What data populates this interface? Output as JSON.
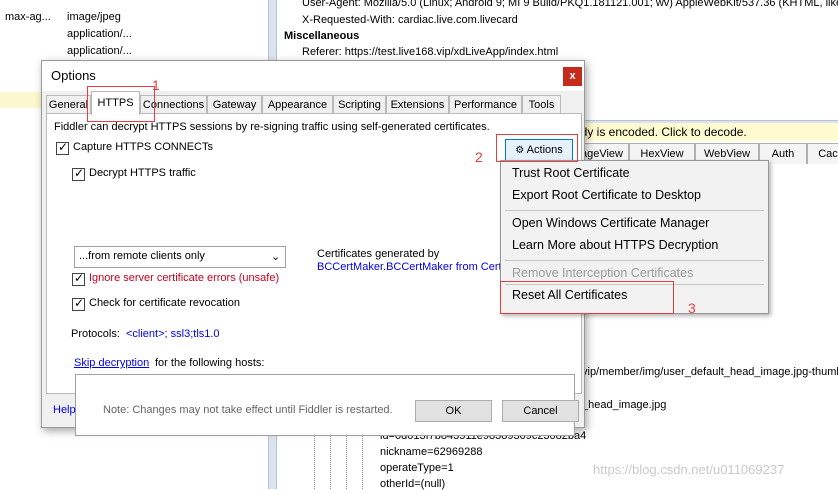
{
  "background": {
    "left_list": [
      {
        "name": "max-ag...",
        "type": "image/jpeg"
      },
      {
        "name": "",
        "type": "application/..."
      },
      {
        "name": "",
        "type": "application/..."
      }
    ],
    "headers": {
      "user_agent": "User-Agent: Mozilla/5.0 (Linux; Android 9; MI 9 Build/PKQ1.181121.001; wv) AppleWebKit/537.36 (KHTML, like",
      "x_requested_with": "X-Requested-With: cardiac.live.com.livecard",
      "section": "Miscellaneous",
      "referer": "Referer: https://test.live168.vip/xdLiveApp/index.html"
    },
    "encoded_notice": "ody is encoded. Click to decode.",
    "response_tabs": [
      "ageView",
      "HexView",
      "WebView",
      "Auth",
      "Cac"
    ],
    "tree_lines": [
      "vip/member/img/user_default_head_image.jpg-thumb",
      "_head_image.jpg",
      "id=0d013f7b843511e98389309c23082ba4",
      "nickname=62969288",
      "operateType=1",
      "otherId=(null)"
    ],
    "watermark": "https://blog.csdn.net/u011069237"
  },
  "dialog": {
    "title": "Options",
    "close_label": "x",
    "tabs": [
      "General",
      "HTTPS",
      "Connections",
      "Gateway",
      "Appearance",
      "Scripting",
      "Extensions",
      "Performance",
      "Tools"
    ],
    "active_tab": "HTTPS",
    "description": "Fiddler can decrypt HTTPS sessions by re-signing traffic using self-generated certificates.",
    "capture_connects": "Capture HTTPS CONNECTs",
    "decrypt_traffic": "Decrypt HTTPS traffic",
    "source_select": "...from remote clients only",
    "ignore_errors": "Ignore server certificate errors (unsafe)",
    "revocation": "Check for certificate revocation",
    "certs_label": "Certificates generated by",
    "certs_value": "BCCertMaker.BCCertMaker from Cert",
    "protocols_label": "Protocols:",
    "protocols_value": "<client>; ssl3;tls1.0",
    "skip_link": "Skip decryption",
    "skip_rest": "for the following hosts:",
    "actions_label": "Actions",
    "help_label": "Help",
    "note": "Note: Changes may not take effect until Fiddler is restarted.",
    "ok_label": "OK",
    "cancel_label": "Cancel"
  },
  "menu": {
    "items": [
      "Trust Root Certificate",
      "Export Root Certificate to Desktop",
      "Open Windows Certificate Manager",
      "Learn More about HTTPS Decryption",
      "Remove Interception Certificates",
      "Reset All Certificates"
    ]
  },
  "annotations": [
    "1",
    "2",
    "3"
  ],
  "colors": {
    "accent_red": "#e24040",
    "link_blue": "#0000ee",
    "warning_red": "#c8001e",
    "close_red": "#c42b1c"
  }
}
